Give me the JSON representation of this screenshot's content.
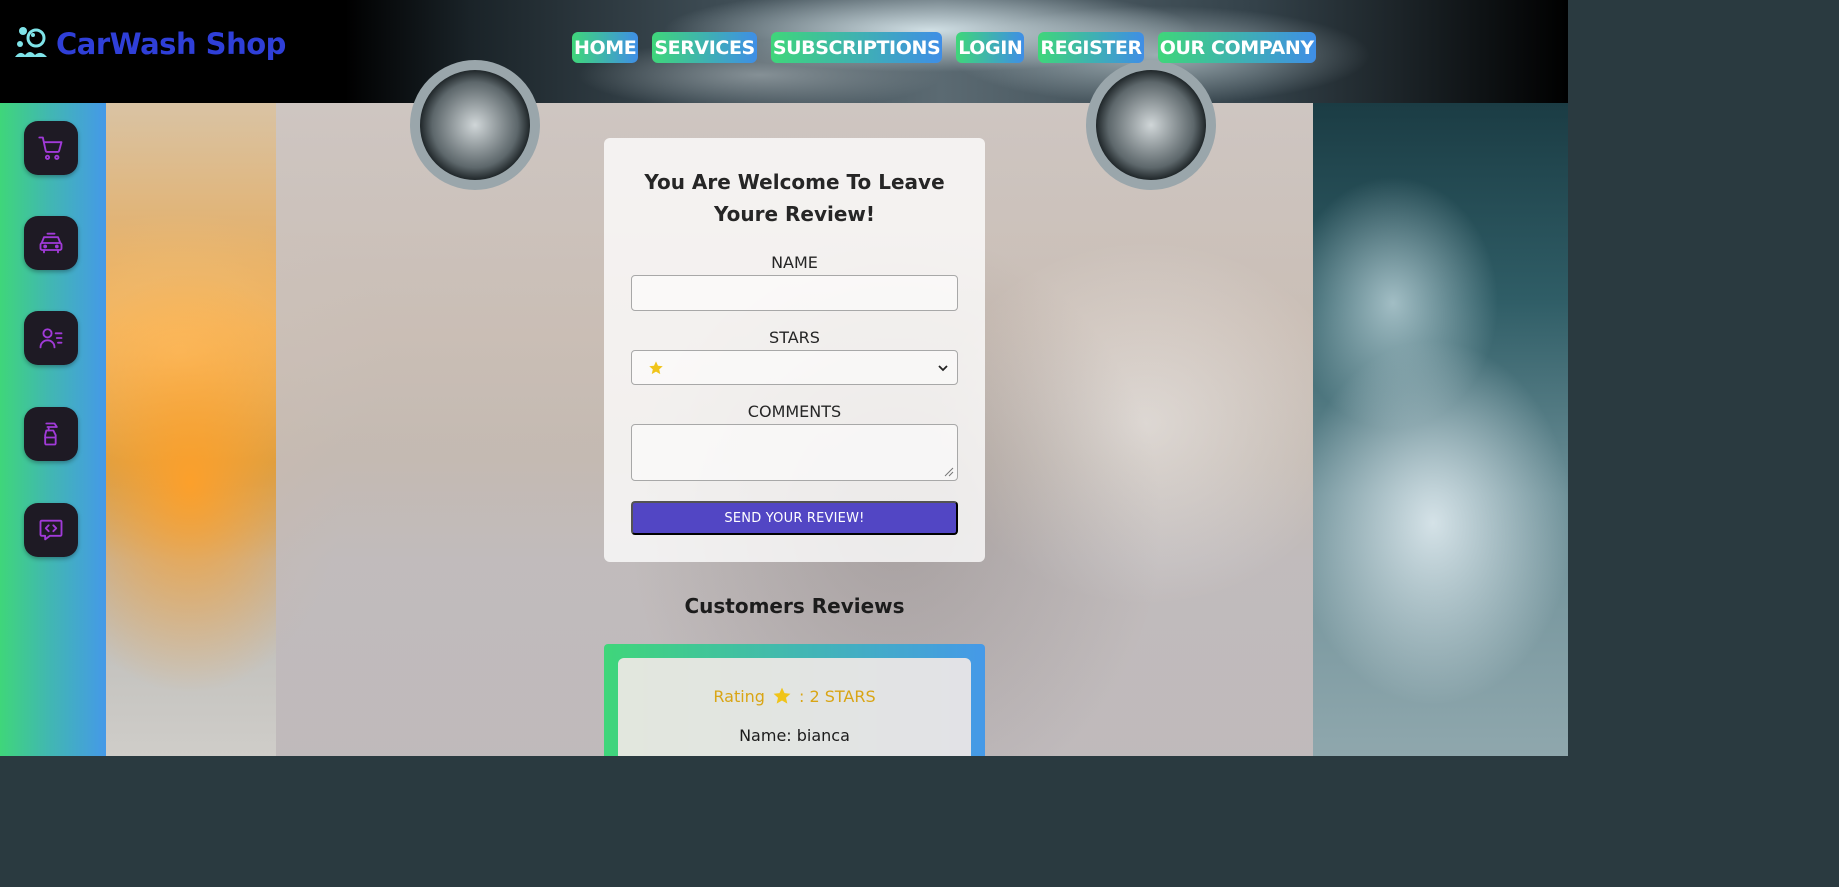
{
  "brand": {
    "name": "CarWash Shop"
  },
  "nav": {
    "items": [
      "HOME",
      "SERVICES",
      "SUBSCRIPTIONS",
      "LOGIN",
      "REGISTER",
      "OUR COMPANY"
    ]
  },
  "sidebar": {
    "icons": [
      "cart-icon",
      "car-icon",
      "user-list-icon",
      "spray-bottle-icon",
      "code-message-icon"
    ],
    "icon_color": "#a13ad8"
  },
  "review_form": {
    "title_line1": "You Are Welcome To Leave",
    "title_line2": "Youre Review!",
    "name_label": "NAME",
    "name_value": "",
    "stars_label": "STARS",
    "stars_selected": "1 star",
    "comments_label": "COMMENTS",
    "comments_value": "",
    "submit_label": "SEND YOUR REVIEW!"
  },
  "reviews": {
    "heading": "Customers Reviews",
    "items": [
      {
        "rating_prefix": "Rating",
        "rating_suffix": ": 2 STARS",
        "name": "Name: bianca"
      }
    ]
  },
  "colors": {
    "brand_text": "#2f3fd8",
    "nav_gradient_start": "#3fd67a",
    "nav_gradient_end": "#3f8ee6",
    "submit_button": "#5246c4",
    "rating_text": "#d9a515",
    "star": "#f0c419"
  }
}
